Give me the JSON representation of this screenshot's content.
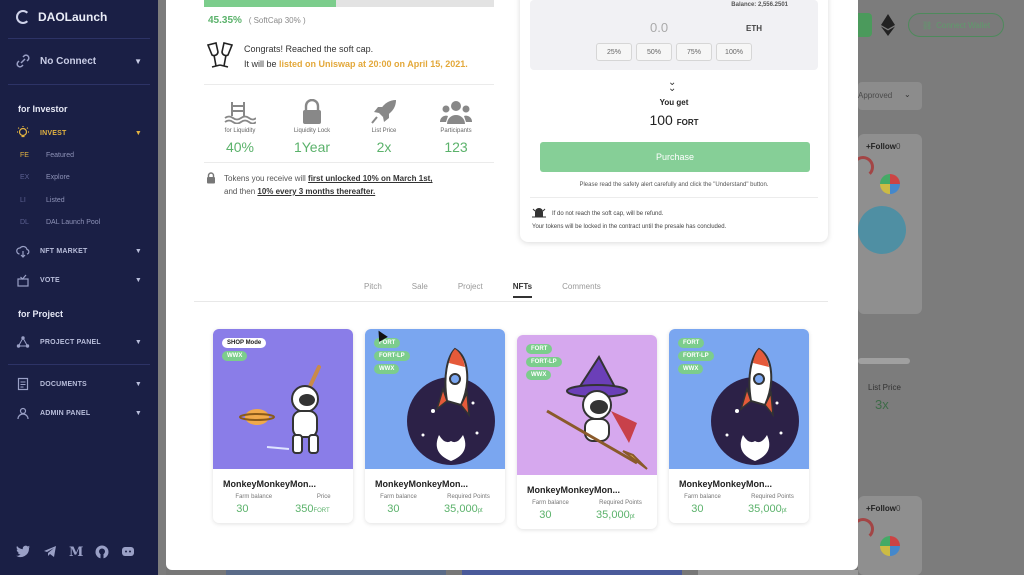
{
  "sidebar": {
    "brand": "DAOLaunch",
    "connect": "No Connect",
    "section_investor": "for Investor",
    "section_project": "for Project",
    "items": [
      {
        "label": "INVEST",
        "icon": "lightbulb-icon"
      },
      {
        "label": "NFT MARKET",
        "icon": "cloud-download-icon"
      },
      {
        "label": "VOTE",
        "icon": "vote-icon"
      },
      {
        "label": "PROJECT PANEL",
        "icon": "network-icon"
      },
      {
        "label": "DOCUMENTS",
        "icon": "document-icon"
      },
      {
        "label": "ADMIN PANEL",
        "icon": "admin-icon"
      }
    ],
    "subitems": [
      {
        "abbr": "FE",
        "label": "Featured"
      },
      {
        "abbr": "EX",
        "label": "Explore"
      },
      {
        "abbr": "LI",
        "label": "Listed"
      },
      {
        "abbr": "DL",
        "label": "DAL Launch Pool"
      }
    ]
  },
  "background": {
    "connect_wallet": "Connect Wallet",
    "approved": "Approved",
    "follow_1": "+Follow",
    "follow_count_1": "0",
    "follow_2": "+Follow",
    "follow_count_2": "0",
    "list_price_label": "List Price",
    "list_price_value": "3x"
  },
  "sale": {
    "progress_percent": 45.35,
    "progress_text": "45.35%",
    "softcap_text": "( SoftCap 30% )",
    "congrats_line1": "Congrats! Reached the soft cap.",
    "congrats_prefix": "It will be ",
    "congrats_highlight": "listed on Uniswap at 20:00 on April 15, 2021.",
    "stats": [
      {
        "label": "for Liquidity",
        "value": "40%",
        "icon": "pool-icon"
      },
      {
        "label": "Liquidity Lock",
        "value": "1Year",
        "icon": "lock-icon"
      },
      {
        "label": "List Price",
        "value": "2x",
        "icon": "rocket-icon"
      },
      {
        "label": "Participants",
        "value": "123",
        "icon": "participants-icon"
      }
    ],
    "unlock_prefix": "Tokens you receive will ",
    "unlock_bold1": "first unlocked 10% on March 1st,",
    "unlock_mid": "and then ",
    "unlock_bold2": "10% every 3 months thereafter."
  },
  "purchase": {
    "balance": "Balance: 2,556.2501",
    "amount_placeholder": "0.0",
    "currency": "ETH",
    "percent_buttons": [
      "25%",
      "50%",
      "75%",
      "100%"
    ],
    "you_get_label": "You get",
    "you_get_amount": "100",
    "you_get_token": "FORT",
    "button": "Purchase",
    "safety_note": "Please read the safety alert carefully and click the \"Understand\" button.",
    "note_refund": "If do not reach the soft cap, will be refund.",
    "note_locked": "Your tokens will be locked in the contract until the presale has concluded."
  },
  "tabs": [
    "Pitch",
    "Sale",
    "Project",
    "NFTs",
    "Comments"
  ],
  "active_tab": "NFTs",
  "nfts": [
    {
      "name": "MonkeyMonkeyMon...",
      "tags": [
        "SHOP Mode",
        "WWX"
      ],
      "label_a": "Farm balance",
      "value_a": "30",
      "label_b": "Price",
      "value_b": "350",
      "unit_b": "FORT",
      "bg": "#8a7de8"
    },
    {
      "name": "MonkeyMonkeyMon...",
      "tags": [
        "FORT",
        "FORT-LP",
        "WWX"
      ],
      "label_a": "Farm balance",
      "value_a": "30",
      "label_b": "Required Points",
      "value_b": "35,000",
      "unit_b": "pt",
      "bg": "#7aa6f0"
    },
    {
      "name": "MonkeyMonkeyMon...",
      "tags": [
        "FORT",
        "FORT-LP",
        "WWX"
      ],
      "label_a": "Farm balance",
      "value_a": "30",
      "label_b": "Required Points",
      "value_b": "35,000",
      "unit_b": "pt",
      "bg": "#d6a8ee"
    },
    {
      "name": "MonkeyMonkeyMon...",
      "tags": [
        "FORT",
        "FORT-LP",
        "WWX"
      ],
      "label_a": "Farm balance",
      "value_a": "30",
      "label_b": "Required Points",
      "value_b": "35,000",
      "unit_b": "pt",
      "bg": "#7aa6f0"
    }
  ]
}
